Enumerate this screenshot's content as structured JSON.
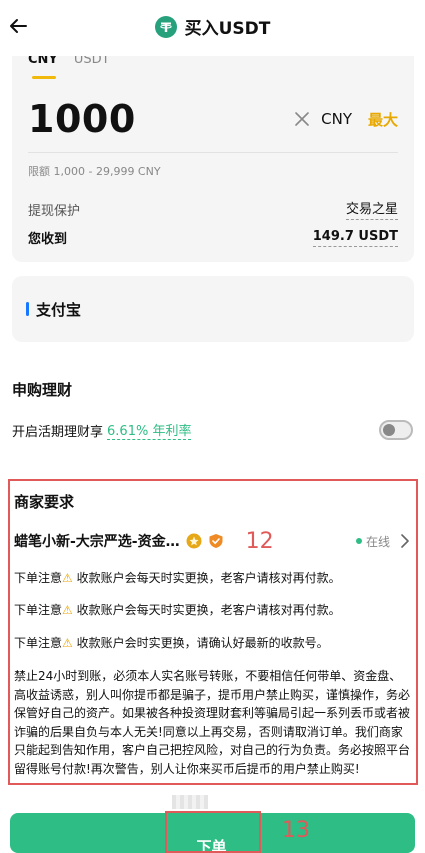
{
  "header": {
    "title": "买入USDT",
    "back_icon": "back-arrow-icon",
    "logo_icon": "tether-logo-icon"
  },
  "amount_card": {
    "tabs": [
      "CNY",
      "USDT"
    ],
    "active_tab": "CNY",
    "amount": "1000",
    "currency": "CNY",
    "max_label": "最大",
    "limit_text": "限额 1,000 - 29,999 CNY",
    "protection_label": "提现保护",
    "protection_value": "交易之星",
    "receive_label": "您收到",
    "receive_value": "149.7 USDT"
  },
  "payment": {
    "method": "支付宝"
  },
  "earn": {
    "section_title": "申购理财",
    "label": "开启活期理财享",
    "rate": "6.61% 年利率",
    "toggle_on": false
  },
  "merchant": {
    "section_title": "商家要求",
    "name": "蜡笔小新-大宗严选-资金…",
    "status": "在线",
    "annotation": "12",
    "notices": [
      {
        "prefix": "下单注意",
        "icon": "warning-icon",
        "text": "  收款账户会每天时实更换，老客户请核对再付款。"
      },
      {
        "prefix": "下单注意",
        "icon": "warning-icon",
        "text": "  收款账户会每天时实更换，老客户请核对再付款。"
      },
      {
        "prefix": "下单注意",
        "icon": "warning-icon",
        "text": "  收款账户会时实更换，请确认好最新的收款号。"
      }
    ],
    "long_notice": "禁止24小时到账，必须本人实名账号转账，不要相信任何带单、资金盘、高收益诱惑，别人叫你提币都是骗子，提币用户禁止购买，谨慎操作，务必保管好自己的资产。如果被各种投资理财套利等骗局引起一系列丢币或者被诈骗的后果自负与本人无关!同意以上再交易，否则请取消订单。我们商家只能起到告知作用，客户自己把控风险，对自己的行为负责。务必按照平台留得账号付款!再次警告，别人让你来买币后提币的用户禁止购买!"
  },
  "footer": {
    "order_button": "下单",
    "annotation": "13"
  },
  "colors": {
    "accent_green": "#2ebd85",
    "max_yellow": "#e8a800",
    "annotation_red": "#e05a5a",
    "tab_indicator": "#f0b90b"
  }
}
